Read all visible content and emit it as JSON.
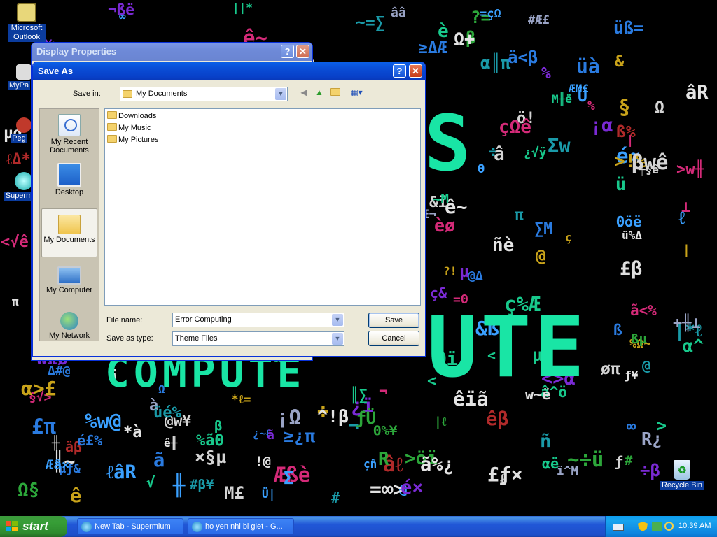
{
  "desktop": {
    "icons": [
      {
        "label": "Microsoft Outlook",
        "icon": "outlook-icon"
      },
      {
        "label": "MyPa",
        "icon": "program-icon"
      },
      {
        "label": "Peg",
        "icon": "program-icon"
      },
      {
        "label": "Superm",
        "icon": "globe-icon"
      },
      {
        "label": "Recycle Bin",
        "icon": "recycle-bin-icon"
      }
    ],
    "wallpaper_word_1": "S",
    "wallpaper_word_2": "UTE",
    "wallpaper_word_3": "COMPUTE"
  },
  "display_properties": {
    "title": "Display Properties",
    "help": "?",
    "close": "✕"
  },
  "save_as": {
    "title": "Save As",
    "help": "?",
    "close": "✕",
    "save_in_label": "Save in:",
    "save_in_value": "My Documents",
    "places": [
      {
        "label": "My Recent Documents",
        "icon": "recent-documents-icon"
      },
      {
        "label": "Desktop",
        "icon": "desktop-icon"
      },
      {
        "label": "My Documents",
        "icon": "my-documents-icon"
      },
      {
        "label": "My Computer",
        "icon": "my-computer-icon"
      },
      {
        "label": "My Network",
        "icon": "my-network-icon"
      }
    ],
    "files": [
      {
        "name": "Downloads",
        "icon": "folder-icon"
      },
      {
        "name": "My Music",
        "icon": "folder-icon"
      },
      {
        "name": "My Pictures",
        "icon": "folder-icon"
      }
    ],
    "file_name_label": "File name:",
    "file_name_value": "Error Computing",
    "save_as_type_label": "Save as type:",
    "save_as_type_value": "Theme Files",
    "save_button": "Save",
    "cancel_button": "Cancel"
  },
  "taskbar": {
    "start_label": "start",
    "tasks": [
      {
        "label": "New Tab - Supermium",
        "icon": "browser-icon"
      },
      {
        "label": "ho yen nhi bi giet - G...",
        "icon": "browser-icon"
      }
    ],
    "clock": "10:39 AM"
  },
  "colors": {
    "wallpaper_accent": "#19e5a5",
    "xp_blue": "#0a5fe8",
    "start_green": "#379e37",
    "dialog_face": "#ece9d8"
  }
}
